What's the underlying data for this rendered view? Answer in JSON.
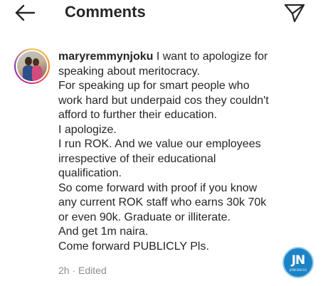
{
  "header": {
    "title": "Comments",
    "back_icon": "arrow-left-icon",
    "send_icon": "paper-plane-icon"
  },
  "comment": {
    "avatar_icon": "avatar",
    "username": "maryremmynjoku",
    "text": " I want to apologize for\nspeaking about meritocracy.\nFor speaking up for smart people who\nwork hard but underpaid cos they couldn't\nafford to further their education.\nI apologize.\nI run ROK. And we value our employees\nirrespective of their educational\nqualification.\nSo come forward with proof if you know\nany current ROK staff who earns 30k 70k\nor even 90k. Graduate or illiterate.\nAnd get 1m naira.\nCome forward PUBLICLY Pls.",
    "time": "2h",
    "separator": "·",
    "edited_label": "Edited"
  },
  "watermark": {
    "logo_text": "JN",
    "sub_text": "JAMESNICKS"
  },
  "colors": {
    "text": "#262626",
    "meta": "#8e8e8e",
    "watermark": "#1d83c6"
  }
}
